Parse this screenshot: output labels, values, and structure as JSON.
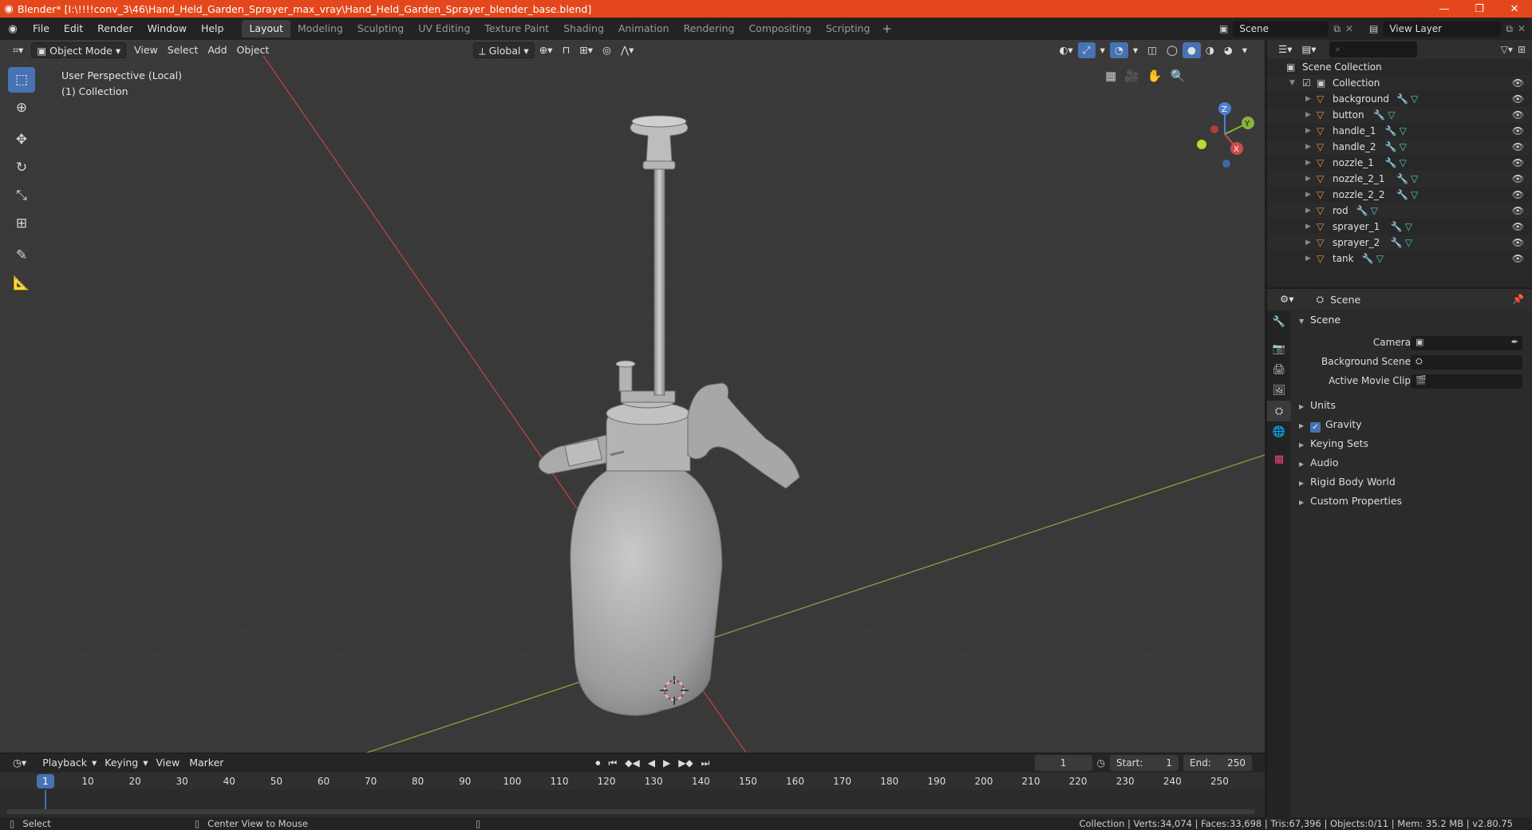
{
  "window": {
    "title": "Blender* [I:\\!!!!conv_3\\46\\Hand_Held_Garden_Sprayer_max_vray\\Hand_Held_Garden_Sprayer_blender_base.blend]",
    "minimize": "—",
    "maximize": "❐",
    "close": "✕"
  },
  "menu": [
    "File",
    "Edit",
    "Render",
    "Window",
    "Help"
  ],
  "workspaces": [
    "Layout",
    "Modeling",
    "Sculpting",
    "UV Editing",
    "Texture Paint",
    "Shading",
    "Animation",
    "Rendering",
    "Compositing",
    "Scripting"
  ],
  "active_workspace": "Layout",
  "scene_field": "Scene",
  "view_layer_field": "View Layer",
  "viewport": {
    "mode": "Object Mode",
    "menus": [
      "View",
      "Select",
      "Add",
      "Object"
    ],
    "orientation": "Global",
    "overlay_line1": "User Perspective (Local)",
    "overlay_line2": "(1) Collection",
    "gizmo_axes": [
      "Z",
      "Y",
      "X"
    ]
  },
  "outliner": {
    "root": "Scene Collection",
    "collection": "Collection",
    "objects": [
      "background",
      "button",
      "handle_1",
      "handle_2",
      "nozzle_1",
      "nozzle_2_1",
      "nozzle_2_2",
      "rod",
      "sprayer_1",
      "sprayer_2",
      "tank"
    ]
  },
  "properties": {
    "header": "Scene",
    "panel": "Scene",
    "fields": [
      {
        "label": "Camera"
      },
      {
        "label": "Background Scene"
      },
      {
        "label": "Active Movie Clip"
      }
    ],
    "subpanels": [
      "Units",
      "Gravity",
      "Keying Sets",
      "Audio",
      "Rigid Body World",
      "Custom Properties"
    ]
  },
  "timeline": {
    "menus": [
      "Playback",
      "Keying",
      "View",
      "Marker"
    ],
    "current_frame": "1",
    "start_label": "Start:",
    "start": "1",
    "end_label": "End:",
    "end": "250",
    "ticks": [
      "10",
      "20",
      "30",
      "40",
      "50",
      "60",
      "70",
      "80",
      "90",
      "100",
      "110",
      "120",
      "130",
      "140",
      "150",
      "160",
      "170",
      "180",
      "190",
      "200",
      "210",
      "220",
      "230",
      "240",
      "250"
    ]
  },
  "status": {
    "left_action": "Select",
    "mid_action": "Center View to Mouse",
    "stats": "Collection | Verts:34,074 | Faces:33,698 | Tris:67,396 | Objects:0/11 | Mem: 35.2 MB | v2.80.75"
  }
}
